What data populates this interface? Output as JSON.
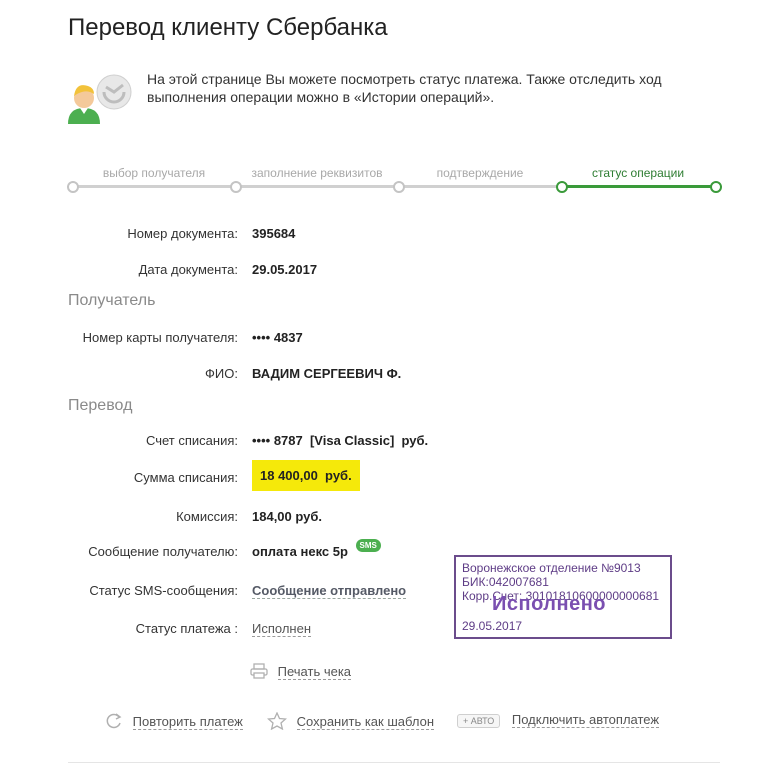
{
  "page": {
    "title": "Перевод клиенту Сбербанка",
    "intro": "На этой странице Вы можете посмотреть статус платежа. Также отследить ход выполнения операции можно в «Истории операций»."
  },
  "steps": [
    {
      "label": "выбор получателя",
      "active": false
    },
    {
      "label": "заполнение реквизитов",
      "active": false
    },
    {
      "label": "подтверждение",
      "active": false
    },
    {
      "label": "статус операции",
      "active": true
    }
  ],
  "document": {
    "number_label": "Номер документа:",
    "number_value": "395684",
    "date_label": "Дата документа:",
    "date_value": "29.05.2017"
  },
  "recipient": {
    "section_title": "Получатель",
    "card_label": "Номер карты получателя:",
    "card_value": "•••• 4837",
    "name_label": "ФИО:",
    "name_value": "ВАДИМ СЕРГЕЕВИЧ Ф."
  },
  "transfer": {
    "section_title": "Перевод",
    "account_label": "Счет списания:",
    "account_value": "•••• 8787  [Visa Classic]  руб.",
    "amount_label": "Сумма списания:",
    "amount_value": "18 400,00  руб.",
    "fee_label": "Комиссия:",
    "fee_value": "184,00 руб.",
    "message_label": "Сообщение получателю:",
    "message_value": "оплата некс 5р",
    "sms_badge": "SMS",
    "sms_status_label": "Статус SMS-сообщения:",
    "sms_status_value": "Сообщение отправлено",
    "payment_status_label": "Статус платежа :",
    "payment_status_value": "Исполнен"
  },
  "stamp": {
    "line1": "Воронежское отделение №9013",
    "line2": "БИК:042007681",
    "line3": "Корр.Счет: 30101810600000000681",
    "status": "Исполнено",
    "date": "29.05.2017"
  },
  "actions": {
    "print": "Печать чека",
    "repeat": "Повторить платеж",
    "save_template": "Сохранить как шаблон",
    "auto_badge": "+ АВТО",
    "autopay": "Подключить автоплатеж"
  },
  "colors": {
    "accent_green": "#3a9a3a",
    "highlight_yellow": "#f5e90a",
    "stamp_purple": "#6b4c8c"
  }
}
